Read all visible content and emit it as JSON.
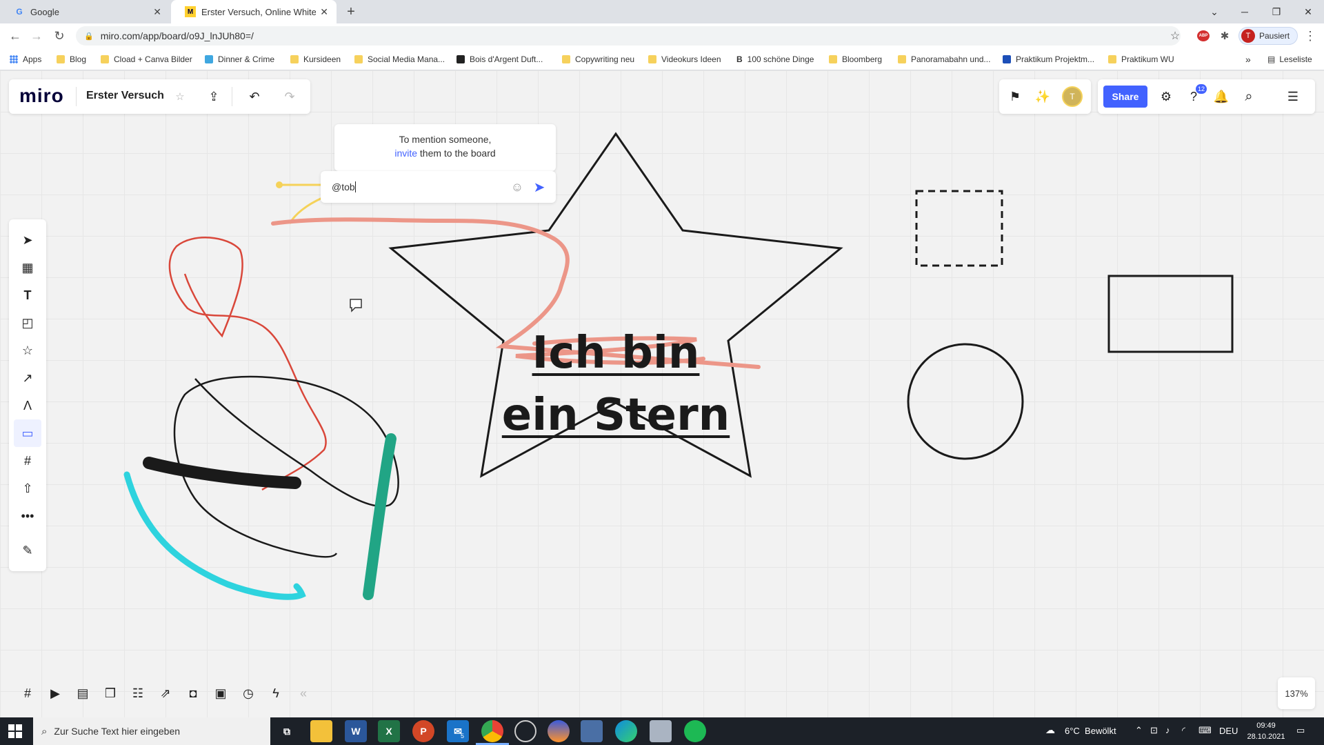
{
  "browser": {
    "tabs": [
      {
        "title": "Google",
        "favicon": "G"
      },
      {
        "title": "Erster Versuch, Online Whiteboar",
        "favicon": "M"
      }
    ],
    "new_tab_label": "+",
    "url": "miro.com/app/board/o9J_lnJUh80=/",
    "profile_label": "Pausiert",
    "profile_initial": "T",
    "bookmarks": [
      "Apps",
      "Blog",
      "Cload + Canva Bilder",
      "Dinner & Crime",
      "Kursideen",
      "Social Media Mana...",
      "Bois d'Argent Duft...",
      "Copywriting neu",
      "Videokurs Ideen",
      "100 schöne Dinge",
      "Bloomberg",
      "Panoramabahn und...",
      "Praktikum Projektm...",
      "Praktikum WU"
    ],
    "more_bookmarks": "»",
    "reading_list": "Leseliste"
  },
  "miro": {
    "logo": "miro",
    "board_title": "Erster Versuch",
    "share_label": "Share",
    "help_badge": "12",
    "avatar_initial": "T",
    "zoom": "137%",
    "collapse_label": "«"
  },
  "mention": {
    "line1": "To mention someone,",
    "link": "invite",
    "line2_rest": " them to the board"
  },
  "comment": {
    "value": "@tob"
  },
  "canvas": {
    "star_line1": "Ich bin",
    "star_line2": "ein Stern",
    "colors": {
      "salmon": "#ec9688",
      "red": "#d9473a",
      "cyan": "#2ed3de",
      "green": "#21a585",
      "yellow": "#f5d259",
      "accent": "#4262ff"
    }
  },
  "taskbar": {
    "search_placeholder": "Zur Suche Text hier eingeben",
    "weather": "6°C  Bewölkt",
    "language": "DEU",
    "time": "09:49",
    "date": "28.10.2021",
    "mail_badge": "5"
  }
}
